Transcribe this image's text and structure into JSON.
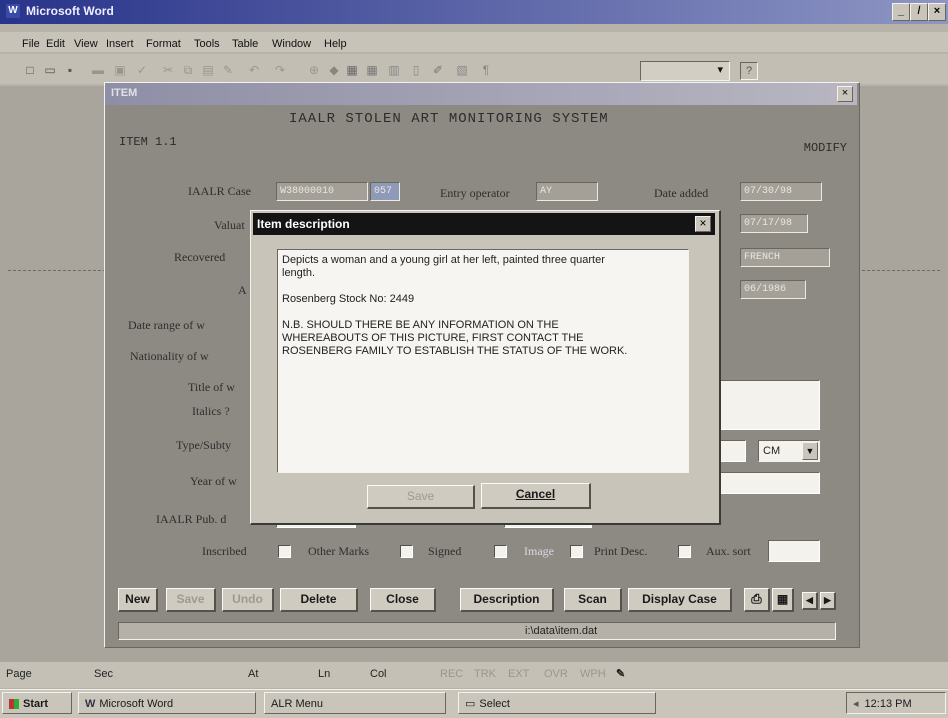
{
  "word": {
    "title": "Microsoft Word",
    "title_icon": "W",
    "window_controls": [
      "_",
      "̸",
      "×"
    ],
    "menu": [
      "File",
      "Edit",
      "View",
      "Insert",
      "Format",
      "Tools",
      "Table",
      "Window",
      "Help"
    ],
    "toolbar_value": "▾",
    "help_glyph": "?"
  },
  "item_window": {
    "title": "ITEM",
    "close_glyph": "×",
    "heading": "IAALR STOLEN ART MONITORING SYSTEM",
    "item_id": "ITEM 1.1",
    "mode": "MODIFY",
    "labels": {
      "case": "IAALR Case",
      "entry_operator": "Entry operator",
      "date_added": "Date added",
      "valuation": "Valuat",
      "recovered": "Recovered",
      "a": "A",
      "date_range": "Date range of w",
      "nationality": "Nationality of w",
      "title_of": "Title of w",
      "italics": "Italics ?",
      "type": "Type/Subty",
      "year": "Year of w",
      "pub": "IAALR Pub. d"
    },
    "fields": {
      "case_no": "W38000010",
      "case_suffix": "057",
      "entry_operator": "AY",
      "date_added": "07/30/98",
      "date_right2": "07/17/98",
      "nationality_right": "FRENCH",
      "date_right4": "06/1986",
      "unit": "CM"
    },
    "checkboxes": [
      "Inscribed",
      "Other Marks",
      "Signed",
      "Image",
      "Print Desc.",
      "Aux. sort"
    ],
    "buttons": [
      "New",
      "Save",
      "Undo",
      "Delete",
      "Close",
      "Description",
      "Scan",
      "Display Case"
    ],
    "path": "i:\\data\\item.dat"
  },
  "dialog": {
    "title": "Item description",
    "close_glyph": "×",
    "lines": [
      "Depicts a woman and a young girl at her left, painted three   quarter",
      "length.",
      "",
      "Rosenberg Stock No:  2449",
      "",
      "N.B.  SHOULD THERE BE ANY INFORMATION ON THE",
      "WHEREABOUTS OF THIS  PICTURE, FIRST CONTACT THE",
      "ROSENBERG FAMILY TO ESTABLISH  THE STATUS OF THE WORK."
    ],
    "save_label": "Save",
    "cancel_label": "Cancel"
  },
  "statusbar": [
    "Page",
    "Sec",
    "At",
    "Ln",
    "Col",
    "REC",
    "TRK",
    "EXT",
    "OVR",
    "WPH"
  ],
  "taskbar": {
    "start": "Start",
    "tasks": [
      "Microsoft Word",
      "ALR Menu",
      "Select"
    ],
    "clock": "12:13 PM"
  }
}
